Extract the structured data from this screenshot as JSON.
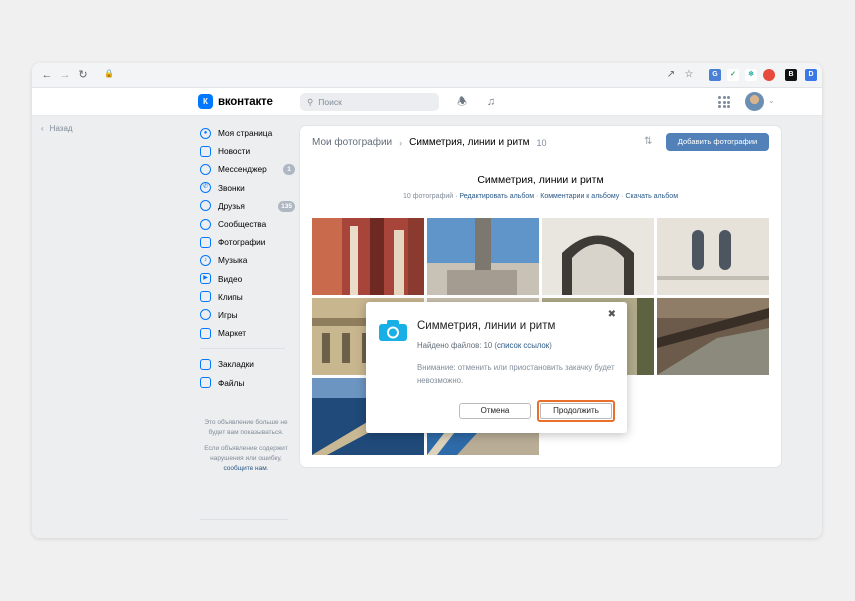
{
  "browser": {
    "back_icon": "arrow-left-icon",
    "forward_icon": "arrow-right-icon",
    "reload_icon": "reload-icon",
    "lock_icon": "lock-icon"
  },
  "header": {
    "logo_text": "вконтакте",
    "logo_mark": "К",
    "search_placeholder": "Поиск",
    "brand_color": "#0077ff"
  },
  "back_label": "Назад",
  "sidebar": {
    "items": [
      {
        "label": "Моя страница",
        "icon": "user-icon"
      },
      {
        "label": "Новости",
        "icon": "news-icon"
      },
      {
        "label": "Мессенджер",
        "icon": "chat-icon",
        "badge": "1"
      },
      {
        "label": "Звонки",
        "icon": "phone-icon"
      },
      {
        "label": "Друзья",
        "icon": "friends-icon",
        "badge": "135"
      },
      {
        "label": "Сообщества",
        "icon": "communities-icon"
      },
      {
        "label": "Фотографии",
        "icon": "photo-icon"
      },
      {
        "label": "Музыка",
        "icon": "music-icon"
      },
      {
        "label": "Видео",
        "icon": "video-icon"
      },
      {
        "label": "Клипы",
        "icon": "clips-icon"
      },
      {
        "label": "Игры",
        "icon": "games-icon"
      },
      {
        "label": "Маркет",
        "icon": "market-icon"
      }
    ],
    "items2": [
      {
        "label": "Закладки",
        "icon": "bookmark-icon"
      },
      {
        "label": "Файлы",
        "icon": "file-icon"
      }
    ]
  },
  "ad": {
    "text1": "Это объявление больше не будет вам показываться.",
    "text2_prefix": "Если объявление содержит нарушения или ошибку,",
    "text2_link": "сообщите нам",
    "text2_suffix": "."
  },
  "album": {
    "breadcrumb_root": "Мои фотографии",
    "breadcrumb_current": "Симметрия, линии и ритм",
    "count": "10",
    "add_button": "Добавить фотографии",
    "title": "Симметрия, линии и ритм",
    "meta_count": "10 фотографий",
    "meta_edit": "Редактировать альбом",
    "meta_comments": "Комментарии к альбому",
    "meta_download": "Скачать альбом"
  },
  "dialog": {
    "title": "Симметрия, линии и ритм",
    "found_prefix": "Найдено файлов: 10 (",
    "found_link": "список ссылок",
    "found_suffix": ")",
    "warning": "Внимание: отменить или приостановить закачку будет невозможно.",
    "cancel": "Отмена",
    "continue": "Продолжить",
    "highlight_color": "#e8702a"
  }
}
